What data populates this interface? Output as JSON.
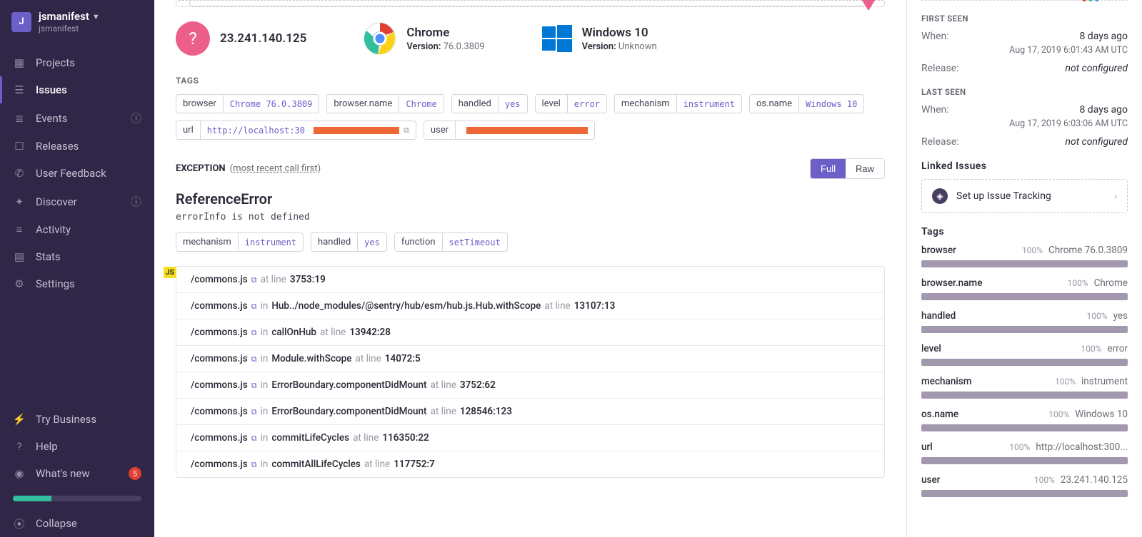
{
  "org": {
    "avatar_letter": "J",
    "name": "jsmanifest",
    "sub": "jsmanifest"
  },
  "nav": {
    "projects": "Projects",
    "issues": "Issues",
    "events": "Events",
    "releases": "Releases",
    "user_feedback": "User Feedback",
    "discover": "Discover",
    "activity": "Activity",
    "stats": "Stats",
    "settings": "Settings",
    "try_business": "Try Business",
    "help": "Help",
    "whats_new": "What's new",
    "whats_new_badge": "5",
    "collapse": "Collapse"
  },
  "env": {
    "ip": "23.241.140.125",
    "browser_name": "Chrome",
    "browser_version_label": "Version:",
    "browser_version": "76.0.3809",
    "os_name": "Windows 10",
    "os_version_label": "Version:",
    "os_version": "Unknown"
  },
  "tags_section": {
    "label": "TAGS"
  },
  "tags": {
    "browser_k": "browser",
    "browser_v": "Chrome 76.0.3809",
    "browsername_k": "browser.name",
    "browsername_v": "Chrome",
    "handled_k": "handled",
    "handled_v": "yes",
    "level_k": "level",
    "level_v": "error",
    "mechanism_k": "mechanism",
    "mechanism_v": "instrument",
    "osname_k": "os.name",
    "osname_v": "Windows 10",
    "url_k": "url",
    "url_v": "http://localhost:30",
    "user_k": "user"
  },
  "exception": {
    "label": "EXCEPTION",
    "note_prefix": "(",
    "note": "most recent call first",
    "note_suffix": ")",
    "full": "Full",
    "raw": "Raw",
    "title": "ReferenceError",
    "message": "errorInfo is not defined",
    "mech_k": "mechanism",
    "mech_v": "instrument",
    "hand_k": "handled",
    "hand_v": "yes",
    "func_k": "function",
    "func_v": "setTimeout"
  },
  "stack": {
    "at_line": "at line",
    "in": "in",
    "js_badge": "JS",
    "frames": [
      {
        "file": "/commons.js",
        "fn": "",
        "loc": "3753:19"
      },
      {
        "file": "/commons.js",
        "fn": "Hub../node_modules/@sentry/hub/esm/hub.js.Hub.withScope",
        "loc": "13107:13"
      },
      {
        "file": "/commons.js",
        "fn": "callOnHub",
        "loc": "13942:28"
      },
      {
        "file": "/commons.js",
        "fn": "Module.withScope",
        "loc": "14072:5"
      },
      {
        "file": "/commons.js",
        "fn": "ErrorBoundary.componentDidMount",
        "loc": "3752:62"
      },
      {
        "file": "/commons.js",
        "fn": "ErrorBoundary.componentDidMount",
        "loc": "128546:123"
      },
      {
        "file": "/commons.js",
        "fn": "commitLifeCycles",
        "loc": "116350:22"
      },
      {
        "file": "/commons.js",
        "fn": "commitAllLifeCycles",
        "loc": "117752:7"
      }
    ]
  },
  "right": {
    "first_seen": "FIRST SEEN",
    "last_seen": "LAST SEEN",
    "when": "When:",
    "release": "Release:",
    "not_configured": "not configured",
    "first_when_val": "8 days ago",
    "first_ts": "Aug 17, 2019 6:01:43 AM UTC",
    "last_when_val": "8 days ago",
    "last_ts": "Aug 17, 2019 6:03:06 AM UTC",
    "linked_issues": "Linked Issues",
    "setup_tracking": "Set up Issue Tracking",
    "tags_label": "Tags",
    "tag_stats": [
      {
        "name": "browser",
        "pct": "100%",
        "val": "Chrome 76.0.3809"
      },
      {
        "name": "browser.name",
        "pct": "100%",
        "val": "Chrome"
      },
      {
        "name": "handled",
        "pct": "100%",
        "val": "yes"
      },
      {
        "name": "level",
        "pct": "100%",
        "val": "error"
      },
      {
        "name": "mechanism",
        "pct": "100%",
        "val": "instrument"
      },
      {
        "name": "os.name",
        "pct": "100%",
        "val": "Windows 10"
      },
      {
        "name": "url",
        "pct": "100%",
        "val": "http://localhost:300..."
      },
      {
        "name": "user",
        "pct": "100%",
        "val": "23.241.140.125"
      }
    ]
  }
}
